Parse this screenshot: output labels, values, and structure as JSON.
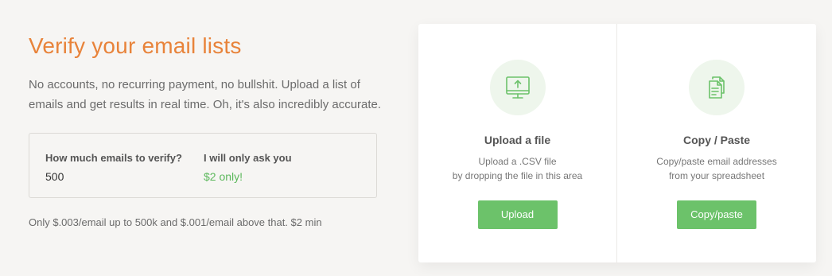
{
  "hero": {
    "title": "Verify your email lists",
    "description": "No accounts, no recurring payment, no bullshit. Upload a list of emails and get results in real time. Oh, it's also incredibly accurate."
  },
  "calculator": {
    "quantity_label": "How much emails to verify?",
    "quantity_value": "500",
    "price_label": "I will only ask you",
    "price_value": "$2 only!"
  },
  "pricing_note": "Only $.003/email up to 500k and $.001/email above that. $2 min",
  "panels": [
    {
      "icon": "monitor-upload-icon",
      "title": "Upload a file",
      "desc_line1": "Upload a .CSV file",
      "desc_line2": "by dropping the file in this area",
      "button": "Upload"
    },
    {
      "icon": "copy-documents-icon",
      "title": "Copy / Paste",
      "desc_line1": "Copy/paste email addresses",
      "desc_line2": "from your spreadsheet",
      "button": "Copy/paste"
    }
  ],
  "colors": {
    "accent": "#e8833a",
    "button_green": "#6cc26a",
    "price_green": "#5cb85c",
    "icon_bg": "#eef6ec",
    "background": "#f6f5f3"
  }
}
